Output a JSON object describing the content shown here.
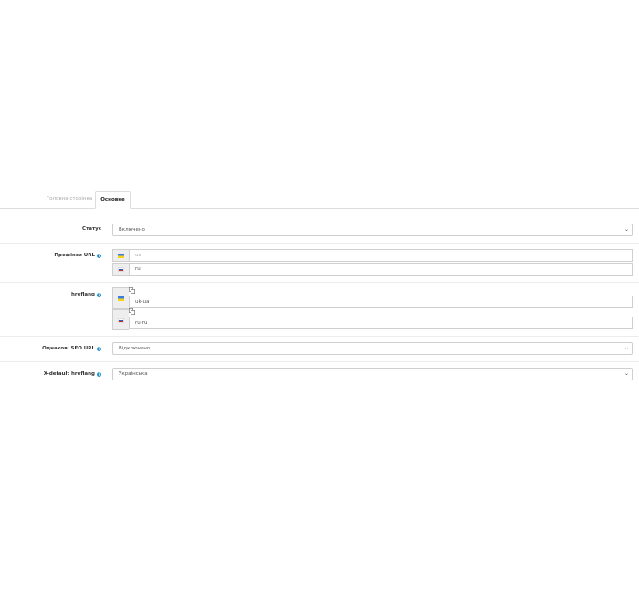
{
  "tabs": [
    {
      "label": "Головна сторінка",
      "active": false
    },
    {
      "label": "Основне",
      "active": true
    }
  ],
  "fields": {
    "status": {
      "label": "Статус",
      "value": "Включено"
    },
    "prefixes": {
      "label": "Префікси URL",
      "help_icon": "question-circle-icon",
      "inputs": [
        {
          "flag": "ua-flag-icon",
          "value": "",
          "placeholder": "ua"
        },
        {
          "flag": "ru-flag-icon",
          "value": "ru",
          "placeholder": ""
        }
      ]
    },
    "hreflang": {
      "label": "hreflang",
      "help_icon": "question-circle-icon",
      "inputs": [
        {
          "flag": "ua-flag-icon",
          "value": "uk-ua"
        },
        {
          "flag": "ru-flag-icon",
          "value": "ru-ru"
        }
      ]
    },
    "same_seo_url": {
      "label": "Однакові SEO URL",
      "help_icon": "question-circle-icon",
      "value": "Відключено"
    },
    "x_default": {
      "label": "X-default hreflang",
      "help_icon": "question-circle-icon",
      "value": "Українська"
    }
  },
  "colors": {
    "help": "#1e91cf",
    "border": "#cfcfcf",
    "addon_bg": "#eeeeee"
  }
}
